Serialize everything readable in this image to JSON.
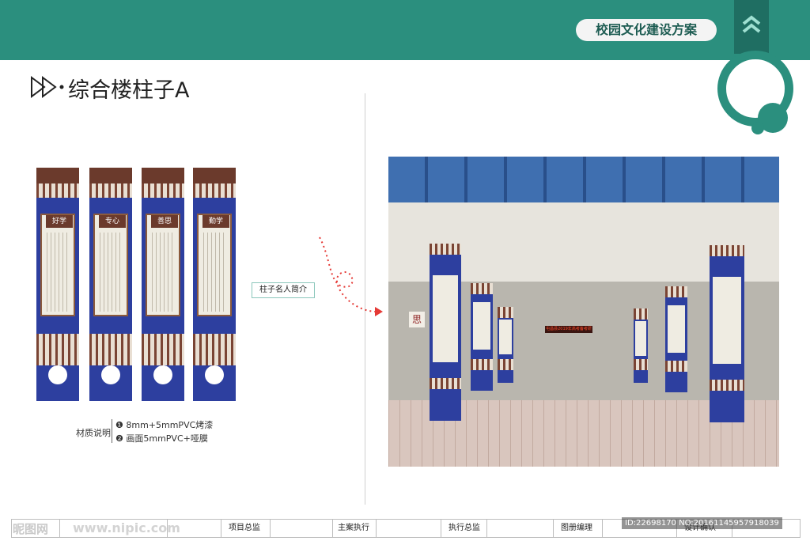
{
  "header": {
    "project_title": "校园文化建设方案",
    "accent_color": "#2b8f7e",
    "icon": "double-chevron-up-icon"
  },
  "page": {
    "title": "综合楼柱子A"
  },
  "pillars": [
    {
      "name": "好学"
    },
    {
      "name": "专心"
    },
    {
      "name": "善思"
    },
    {
      "name": "勤学"
    }
  ],
  "materials": {
    "label": "材质说明",
    "items": [
      "❶ 8mm+5mmPVC烤漆",
      "❷ 画面5mmPVC+哑膜"
    ]
  },
  "callout": {
    "label": "柱子名人简介"
  },
  "photo": {
    "led_text": "屯昌县2019年高考备考研讨会",
    "sign_text": "思"
  },
  "footer": {
    "cells": [
      "项目总监",
      "主案执行",
      "执行总监",
      "图册编理",
      "设计确认"
    ]
  },
  "watermark": {
    "logo": "昵图网",
    "url": "www.nipic.com",
    "id": "ID:22698170 NO:20161145957918039"
  }
}
